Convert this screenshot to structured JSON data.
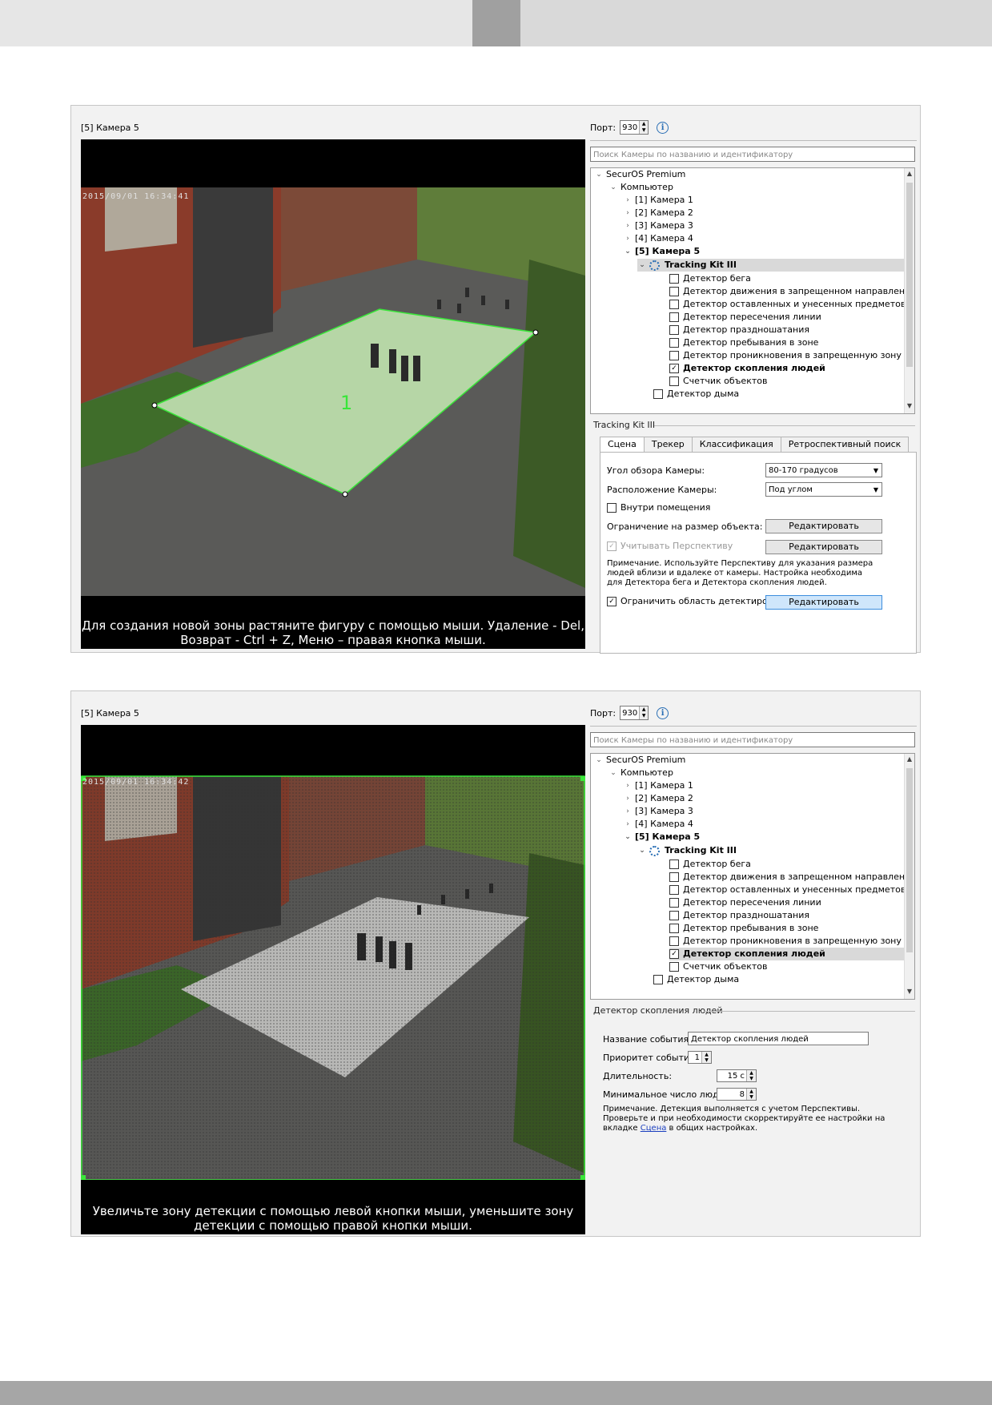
{
  "panel1": {
    "camera_title": "[5] Камера 5",
    "timestamp": "2015/09/01 16:34:41",
    "zone_label": "1",
    "hint": "Для создания новой зоны растяните фигуру с помощью мыши. Удаление - Del, Возврат - Ctrl + Z, Меню – правая кнопка мыши.",
    "port_label": "Порт:",
    "port_value": "930",
    "search_placeholder": "Поиск Камеры по названию и идентификатору",
    "tree": {
      "root": "SecurOS Premium",
      "computer": "Компьютер",
      "cameras": [
        "[1] Камера 1",
        "[2] Камера 2",
        "[3] Камера 3",
        "[4] Камера 4"
      ],
      "selected_camera": "[5] Камера 5",
      "kit": "Tracking Kit III",
      "detectors": [
        {
          "label": "Детектор бега",
          "checked": false
        },
        {
          "label": "Детектор движения в запрещенном направлении",
          "checked": false
        },
        {
          "label": "Детектор оставленных и унесенных предметов",
          "checked": false
        },
        {
          "label": "Детектор пересечения линии",
          "checked": false
        },
        {
          "label": "Детектор праздношатания",
          "checked": false
        },
        {
          "label": "Детектор пребывания в зоне",
          "checked": false
        },
        {
          "label": "Детектор проникновения в запрещенную зону",
          "checked": false
        },
        {
          "label": "Детектор скопления людей",
          "checked": true
        },
        {
          "label": "Счетчик объектов",
          "checked": false
        }
      ],
      "smoke": "Детектор дыма"
    },
    "group_title": "Tracking Kit III",
    "tabs": [
      "Сцена",
      "Трекер",
      "Классификация",
      "Ретроспективный поиск"
    ],
    "fields": {
      "fov_label": "Угол обзора Камеры:",
      "fov_value": "80-170 градусов",
      "placement_label": "Расположение Камеры:",
      "placement_value": "Под углом",
      "indoor_label": "Внутри помещения",
      "size_limit_label": "Ограничение на размер объекта:",
      "perspective_label": "Учитывать Перспективу",
      "edit": "Редактировать",
      "note": "Примечание. Используйте Перспективу для указания размера людей вблизи и вдалеке от камеры. Настройка необходима для Детектора бега и Детектора скопления людей.",
      "restrict_label": "Ограничить область детектирования"
    }
  },
  "panel2": {
    "camera_title": "[5] Камера 5",
    "timestamp": "2015/09/01 16:34:42",
    "hint": "Увеличьте зону детекции с помощью левой кнопки мыши, уменьшите зону детекции с помощью правой кнопки мыши.",
    "port_label": "Порт:",
    "port_value": "930",
    "search_placeholder": "Поиск Камеры по названию и идентификатору",
    "group_title": "Детектор скопления людей",
    "event_name_label": "Название события:",
    "event_name_value": "Детектор скопления людей",
    "priority_label": "Приоритет события:",
    "priority_value": "1",
    "duration_label": "Длительность:",
    "duration_value": "15 с",
    "min_people_label": "Минимальное число людей:",
    "min_people_value": "8",
    "note_prefix": "Примечание. Детекция выполняется с учетом Перспективы. Проверьте и при необходимости скорректируйте ее настройки на вкладке ",
    "note_link": "Сцена",
    "note_suffix": " в общих настройках."
  },
  "colors": {
    "zone_green": "#39e639",
    "highlight_button": "#cfe6fb",
    "info_blue": "#2a6fb5"
  }
}
